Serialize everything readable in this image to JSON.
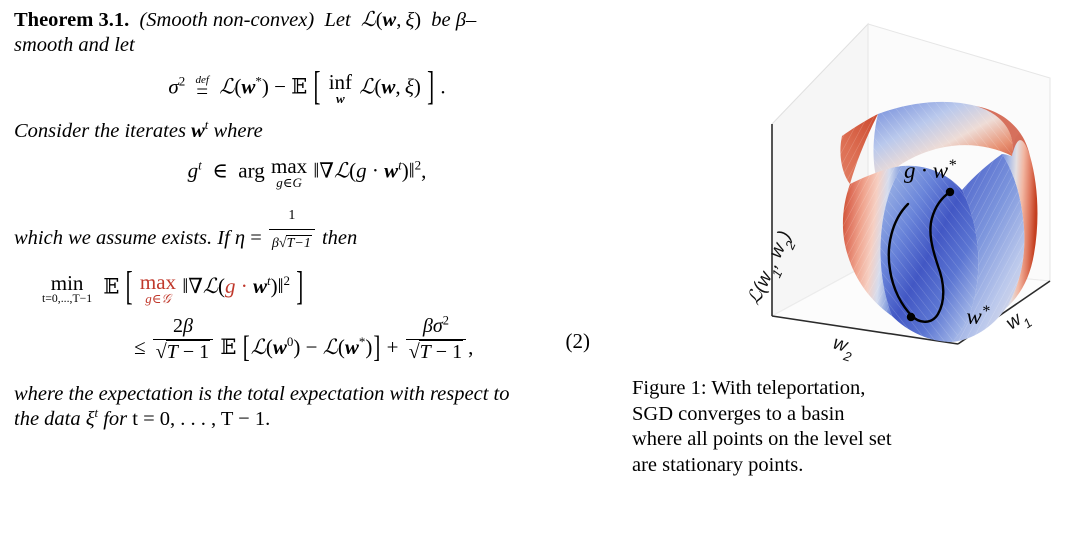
{
  "theorem": {
    "label": "Theorem",
    "number": "3.1.",
    "qualifier": "(Smooth non-convex)",
    "line1_text": "Let",
    "line1_math": "ℒ(w, ξ)",
    "line1_tail": "be β–",
    "line2": "smooth and let",
    "eq1": "σ² =def ℒ(w*) − ℝ[ inf_w ℒ(w, ξ) ].",
    "para2_a": "Consider the iterates",
    "para2_math": "wᵗ",
    "para2_b": "where",
    "eq2": "gᵗ ∈ arg max_{g∈G} ‖∇ℒ(g · wᵗ)‖²,",
    "para3_a": "which we assume exists. If",
    "para3_eta": "η =",
    "para3_frac_num": "1",
    "para3_frac_den": "β√T−1",
    "para3_b": "then",
    "eq3_min_label": "min",
    "eq3_min_sub": "t=0,...,T−1",
    "eq3_E": "𝔼",
    "eq3_max": "max",
    "eq3_max_sub": "g∈𝒢",
    "eq3_body": "‖∇ℒ(g · wᵗ)‖²",
    "eq3_le": "≤",
    "eq3_frac1_num": "2β",
    "eq3_frac1_den": "√T − 1",
    "eq3_mid": "𝔼 [ℒ(w⁰) − ℒ(w*)] +",
    "eq3_frac2_num": "βσ²",
    "eq3_frac2_den": "√T − 1",
    "eq3_comma": ",",
    "eq_number": "(2)",
    "para4_line1": "where the expectation is the total expectation with respect to",
    "para4_line2_a": "the data",
    "para4_line2_math": "ξᵗ",
    "para4_line2_b": "for",
    "para4_line2_c": "t = 0, . . . , T − 1."
  },
  "figure": {
    "caption_prefix": "Figure 1:",
    "caption_text": "With teleportation, SGD converges to a basin where all points on the level set are stationary points.",
    "caption_line1": "Figure 1: With teleportation,",
    "caption_line2": "SGD converges to a basin",
    "caption_line3": "where all points on the level set",
    "caption_line4": "are stationary points.",
    "axis_z": "ℒ(w₁, w₂)",
    "axis_x": "w₂",
    "axis_y": "w₁",
    "point_label_top": "g · w*",
    "point_label_bottom": "w*",
    "colors": {
      "high": "#d1604a",
      "mid": "#f2f1ee",
      "low": "#3b4cc0",
      "panel": "#f4f4f4",
      "pane_edge": "#cfcfcf",
      "axis_line": "#2b2b2b",
      "level_set": "#000000"
    }
  },
  "chart_data": {
    "type": "surface",
    "title": "Loss landscape with level set",
    "xlabel": "w₂",
    "ylabel": "w₁",
    "zlabel": "ℒ(w₁, w₂)",
    "colormap": "coolwarm",
    "annotations": [
      {
        "label": "g · w*",
        "role": "teleported-minimum"
      },
      {
        "label": "w*",
        "role": "minimum"
      }
    ],
    "level_set": "closed curve connecting w* and g · w* in the blue basin",
    "notes": "Saddle-shaped surface; red ridges at high loss, blue valley at low loss"
  }
}
